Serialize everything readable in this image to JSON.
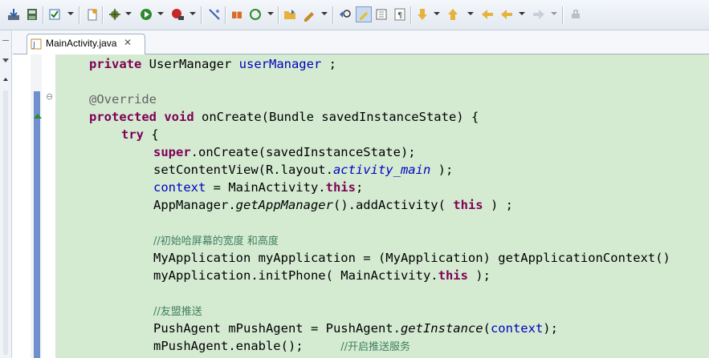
{
  "toolbar": {
    "icons": [
      "download-icon",
      "save-icon",
      "checkbox-icon",
      "new-icon",
      "debug-icon",
      "run-icon",
      "external-tools-icon",
      "skip-icon",
      "build-icon",
      "refresh-icon",
      "open-folder-icon",
      "pen-icon",
      "search-icon",
      "highlight-icon",
      "grid-icon",
      "paragraph-icon",
      "down-icon",
      "up-icon",
      "back-icon",
      "forward-icon",
      "pin-icon"
    ]
  },
  "tab": {
    "label": "MainActivity.java",
    "close": "✕"
  },
  "code": {
    "l1": {
      "kw": "private",
      "type": " UserManager ",
      "field": "userManager",
      "rest": " ;"
    },
    "l2": {
      "ann": "@Override"
    },
    "l3": {
      "kw1": "protected",
      "sp": " ",
      "kw2": "void",
      "rest": " onCreate(Bundle savedInstanceState) {"
    },
    "l4": {
      "kw": "try",
      "rest": " {"
    },
    "l5": {
      "kw": "super",
      "rest": ".onCreate(savedInstanceState);"
    },
    "l6": {
      "a": "setContentView(R.layout.",
      "b": "activity_main",
      "c": " );"
    },
    "l7": {
      "a": "context",
      "b": " = MainActivity.",
      "kw": "this",
      "c": ";"
    },
    "l8": {
      "a": "AppManager.",
      "b": "getAppManager",
      "c": "().addActivity( ",
      "kw": "this",
      "d": " ) ;"
    },
    "l9": {
      "cm": "//初始哈屏幕的宽度 和高度"
    },
    "l10": {
      "a": "MyApplication myApplication = (MyApplication) getApplicationContext()"
    },
    "l11": {
      "a": "myApplication.initPhone( MainActivity.",
      "kw": "this",
      "b": " );"
    },
    "l12": {
      "cm": "//友盟推送"
    },
    "l13": {
      "a": "PushAgent mPushAgent = PushAgent.",
      "b": "getInstance",
      "c": "(",
      "d": "context",
      "e": ");"
    },
    "l14": {
      "a": "mPushAgent.enable();     ",
      "cm": "//开启推送服务"
    }
  },
  "fold": {
    "minus": "⊖"
  }
}
